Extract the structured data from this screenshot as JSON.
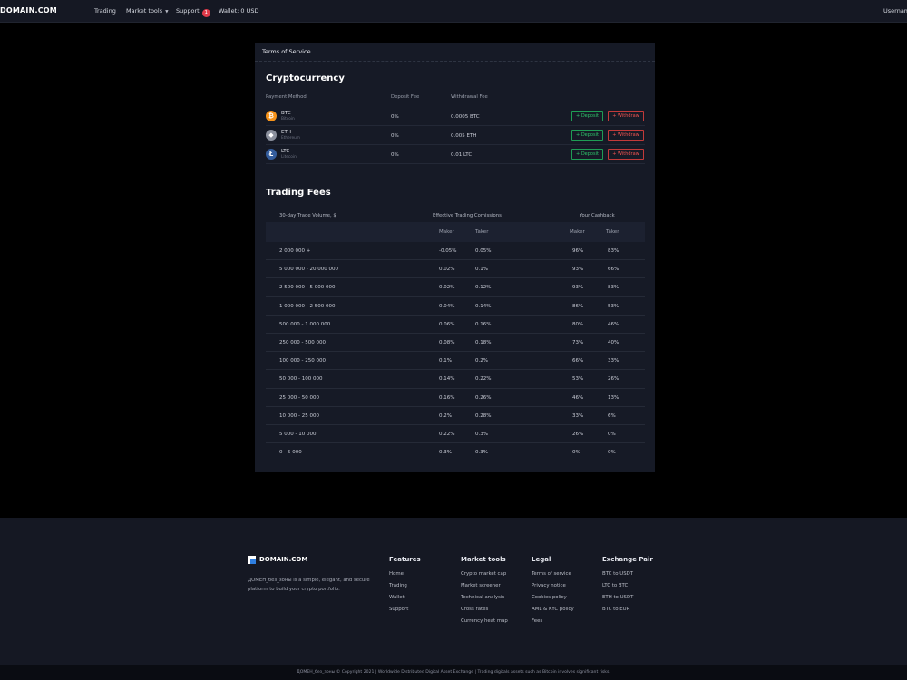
{
  "navbar": {
    "logo": "DOMAIN.COM",
    "items": {
      "trading": "Trading",
      "market_tools": "Market tools",
      "support": "Support",
      "support_badge": "1",
      "wallet": "Wallet: 0 USD"
    },
    "username": "Username"
  },
  "card": {
    "header": "Terms of Service",
    "crypto": {
      "title": "Cryptocurrency",
      "columns": [
        "Payment Method",
        "Deposit Fee",
        "Withdrawal Fee"
      ],
      "deposit_label": "+ Deposit",
      "withdraw_label": "+ Withdraw",
      "rows": [
        {
          "symbol": "BTC",
          "name": "Bitcoin",
          "deposit_fee": "0%",
          "withdrawal_fee": "0.0005 BTC",
          "icon": "bitcoin-icon",
          "color": "#f7931a",
          "glyph": "₿"
        },
        {
          "symbol": "ETH",
          "name": "Ethereum",
          "deposit_fee": "0%",
          "withdrawal_fee": "0.005 ETH",
          "icon": "ethereum-icon",
          "color": "#8a8f9c",
          "glyph": "◆"
        },
        {
          "symbol": "LTC",
          "name": "Litecoin",
          "deposit_fee": "0%",
          "withdrawal_fee": "0.01 LTC",
          "icon": "litecoin-icon",
          "color": "#345d9d",
          "glyph": "Ł"
        }
      ]
    },
    "fees": {
      "title": "Trading Fees",
      "head_volume": "30-day Trade Volume, $",
      "head_commission": "Effective Trading Comissions",
      "head_cashback": "Your Cashback",
      "sub_maker": "Maker",
      "sub_taker": "Taker",
      "rows": [
        {
          "volume": "2 000 000 +",
          "maker": "-0.05%",
          "taker": "0.05%",
          "cb_maker": "96%",
          "cb_taker": "83%"
        },
        {
          "volume": "5 000 000 - 20 000 000",
          "maker": "0.02%",
          "taker": "0.1%",
          "cb_maker": "93%",
          "cb_taker": "66%"
        },
        {
          "volume": "2 500 000 - 5 000 000",
          "maker": "0.02%",
          "taker": "0.12%",
          "cb_maker": "93%",
          "cb_taker": "83%"
        },
        {
          "volume": "1 000 000 - 2 500 000",
          "maker": "0.04%",
          "taker": "0.14%",
          "cb_maker": "86%",
          "cb_taker": "53%"
        },
        {
          "volume": "500 000 - 1 000 000",
          "maker": "0.06%",
          "taker": "0.16%",
          "cb_maker": "80%",
          "cb_taker": "46%"
        },
        {
          "volume": "250 000 - 500 000",
          "maker": "0.08%",
          "taker": "0.18%",
          "cb_maker": "73%",
          "cb_taker": "40%"
        },
        {
          "volume": "100 000 - 250 000",
          "maker": "0.1%",
          "taker": "0.2%",
          "cb_maker": "66%",
          "cb_taker": "33%"
        },
        {
          "volume": "50 000 - 100 000",
          "maker": "0.14%",
          "taker": "0.22%",
          "cb_maker": "53%",
          "cb_taker": "26%"
        },
        {
          "volume": "25 000 - 50 000",
          "maker": "0.16%",
          "taker": "0.26%",
          "cb_maker": "46%",
          "cb_taker": "13%"
        },
        {
          "volume": "10 000 - 25 000",
          "maker": "0.2%",
          "taker": "0.28%",
          "cb_maker": "33%",
          "cb_taker": "6%"
        },
        {
          "volume": "5 000 - 10 000",
          "maker": "0.22%",
          "taker": "0.3%",
          "cb_maker": "26%",
          "cb_taker": "0%"
        },
        {
          "volume": "0 - 5 000",
          "maker": "0.3%",
          "taker": "0.3%",
          "cb_maker": "0%",
          "cb_taker": "0%"
        }
      ]
    }
  },
  "footer": {
    "logo": "DOMAIN.COM",
    "description": "ДОМЕН_без_зоны is a simple, elegant, and secure platform to build your crypto portfolio.",
    "columns": [
      {
        "key": "features",
        "title": "Features",
        "links": [
          "Home",
          "Trading",
          "Wallet",
          "Support"
        ]
      },
      {
        "key": "market-tools",
        "title": "Market tools",
        "links": [
          "Crypto market cap",
          "Market screener",
          "Technical analysis",
          "Cross rates",
          "Currency heat map"
        ]
      },
      {
        "key": "legal",
        "title": "Legal",
        "links": [
          "Terms of service",
          "Privacy notice",
          "Cookies policy",
          "AML & KYC policy",
          "Fees"
        ]
      },
      {
        "key": "exchange-pair",
        "title": "Exchange Pair",
        "links": [
          "BTC to USDT",
          "LTC to BTC",
          "ETH to USDT",
          "BTC to EUR"
        ]
      }
    ],
    "copyright": "ДОМЕН_без_зоны © Copyright 2021 | Worldwide Distributed Digital Asset Exchange | Trading digitals assets such as Bitcoin involves significant risks."
  }
}
